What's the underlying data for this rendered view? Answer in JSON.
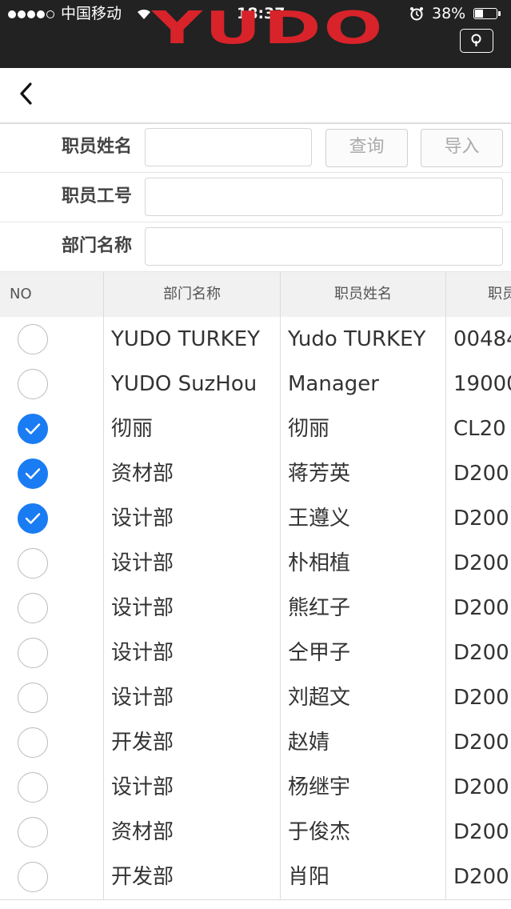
{
  "status_bar": {
    "carrier": "中国移动",
    "time": "18:37",
    "battery": "38%",
    "battery_level": 0.38,
    "signal_bars": 4
  },
  "brand": {
    "logo_text": "YUDO",
    "logo_color": "#d8232a"
  },
  "colors": {
    "accent": "#1a7cf3",
    "topbar": "#222222"
  },
  "search_form": {
    "name_label": "职员姓名",
    "name_value": "",
    "query_button": "查询",
    "import_button": "导入",
    "emp_no_label": "职员工号",
    "emp_no_value": "",
    "dept_label": "部门名称",
    "dept_value": ""
  },
  "table": {
    "headers": [
      "NO",
      "部门名称",
      "职员姓名",
      "职员"
    ],
    "rows": [
      {
        "checked": false,
        "dept": "YUDO TURKEY",
        "name": "Yudo TURKEY",
        "id": "00484"
      },
      {
        "checked": false,
        "dept": "YUDO SuzHou",
        "name": "Manager",
        "id": "19000"
      },
      {
        "checked": true,
        "dept": "彻丽",
        "name": "彻丽",
        "id": "CL20"
      },
      {
        "checked": true,
        "dept": "资材部",
        "name": "蒋芳英",
        "id": "D200"
      },
      {
        "checked": true,
        "dept": "设计部",
        "name": "王遵义",
        "id": "D200"
      },
      {
        "checked": false,
        "dept": "设计部",
        "name": "朴相植",
        "id": "D200"
      },
      {
        "checked": false,
        "dept": "设计部",
        "name": "熊红子",
        "id": "D200"
      },
      {
        "checked": false,
        "dept": "设计部",
        "name": "仝甲子",
        "id": "D200"
      },
      {
        "checked": false,
        "dept": "设计部",
        "name": "刘超文",
        "id": "D200"
      },
      {
        "checked": false,
        "dept": "开发部",
        "name": "赵婧",
        "id": "D200"
      },
      {
        "checked": false,
        "dept": "设计部",
        "name": "杨继宇",
        "id": "D200"
      },
      {
        "checked": false,
        "dept": "资材部",
        "name": "于俊杰",
        "id": "D200"
      },
      {
        "checked": false,
        "dept": "开发部",
        "name": "肖阳",
        "id": "D200"
      }
    ]
  }
}
